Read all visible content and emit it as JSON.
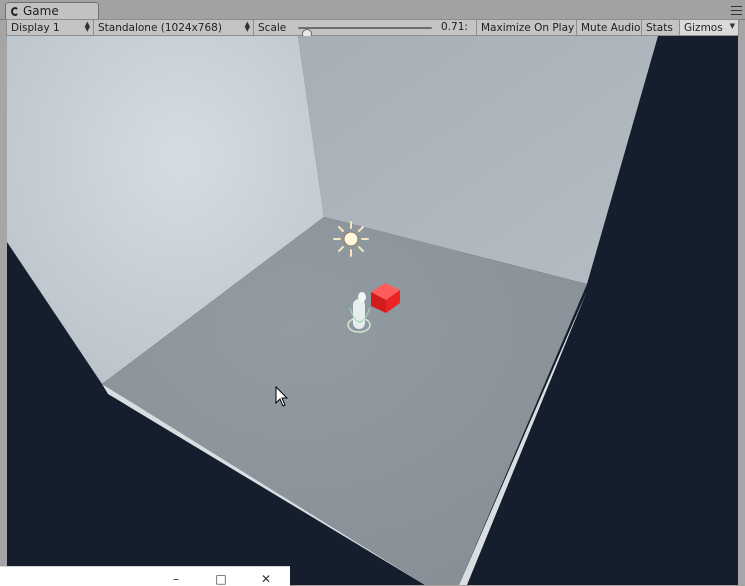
{
  "tab": {
    "icon": "unity-logo-icon",
    "title": "Game"
  },
  "tab_menu": {
    "icon": "panel-menu-icon"
  },
  "toolbar": {
    "display": "Display 1",
    "resolution": "Standalone (1024x768)",
    "scale_label": "Scale",
    "scale_value": "0.71:",
    "scale_fraction": 0.06,
    "maximize_on_play": "Maximize On Play",
    "mute_audio": "Mute Audio",
    "stats": "Stats",
    "gizmos": "Gizmos"
  },
  "scene": {
    "sky_color": "#141e2c",
    "floor_color": "#8c949c",
    "cube_color": "#ee2222",
    "light_icon": "sun-icon",
    "player_icon": "capsule-character-icon",
    "cursor_icon": "mouse-pointer-icon"
  },
  "second_window": {
    "minimize_icon": "minimize-icon",
    "maximize_icon": "maximize-icon",
    "close_icon": "close-icon"
  }
}
